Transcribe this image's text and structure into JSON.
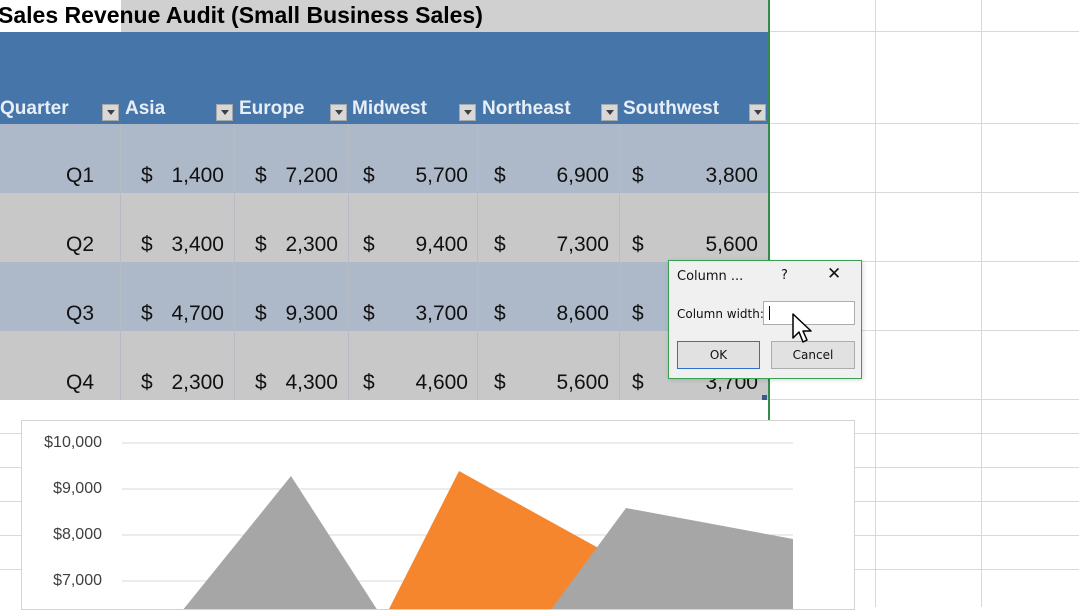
{
  "sheet": {
    "title": "Sales Revenue Audit (Small Business Sales)",
    "headers": [
      "Quarter",
      "Asia",
      "Europe",
      "Midwest",
      "Northeast",
      "Southwest"
    ],
    "rows": [
      {
        "q": "Q1",
        "cur": "$",
        "vals": [
          "1,400",
          "7,200",
          "5,700",
          "6,900",
          "3,800"
        ]
      },
      {
        "q": "Q2",
        "cur": "$",
        "vals": [
          "3,400",
          "2,300",
          "9,400",
          "7,300",
          "5,600"
        ]
      },
      {
        "q": "Q3",
        "cur": "$",
        "vals": [
          "4,700",
          "9,300",
          "3,700",
          "8,600",
          ""
        ]
      },
      {
        "q": "Q4",
        "cur": "$",
        "vals": [
          "2,300",
          "4,300",
          "4,600",
          "5,600",
          "3,700"
        ]
      }
    ]
  },
  "chart_data": {
    "type": "area",
    "y_ticks": [
      "$10,000",
      "$9,000",
      "$8,000",
      "$7,000"
    ],
    "ylim_visible": [
      6500,
      10300
    ],
    "series_colors": [
      "#a6a6a6",
      "#f5862e"
    ],
    "visible_peaks": {
      "gray_1": 9300,
      "orange": 9400,
      "gray_2_left": 8600,
      "gray_2_right": 7900
    }
  },
  "dialog": {
    "title": "Column ...",
    "help": "?",
    "close": "✕",
    "label": "Column width:",
    "value": "",
    "ok": "OK",
    "cancel": "Cancel"
  }
}
